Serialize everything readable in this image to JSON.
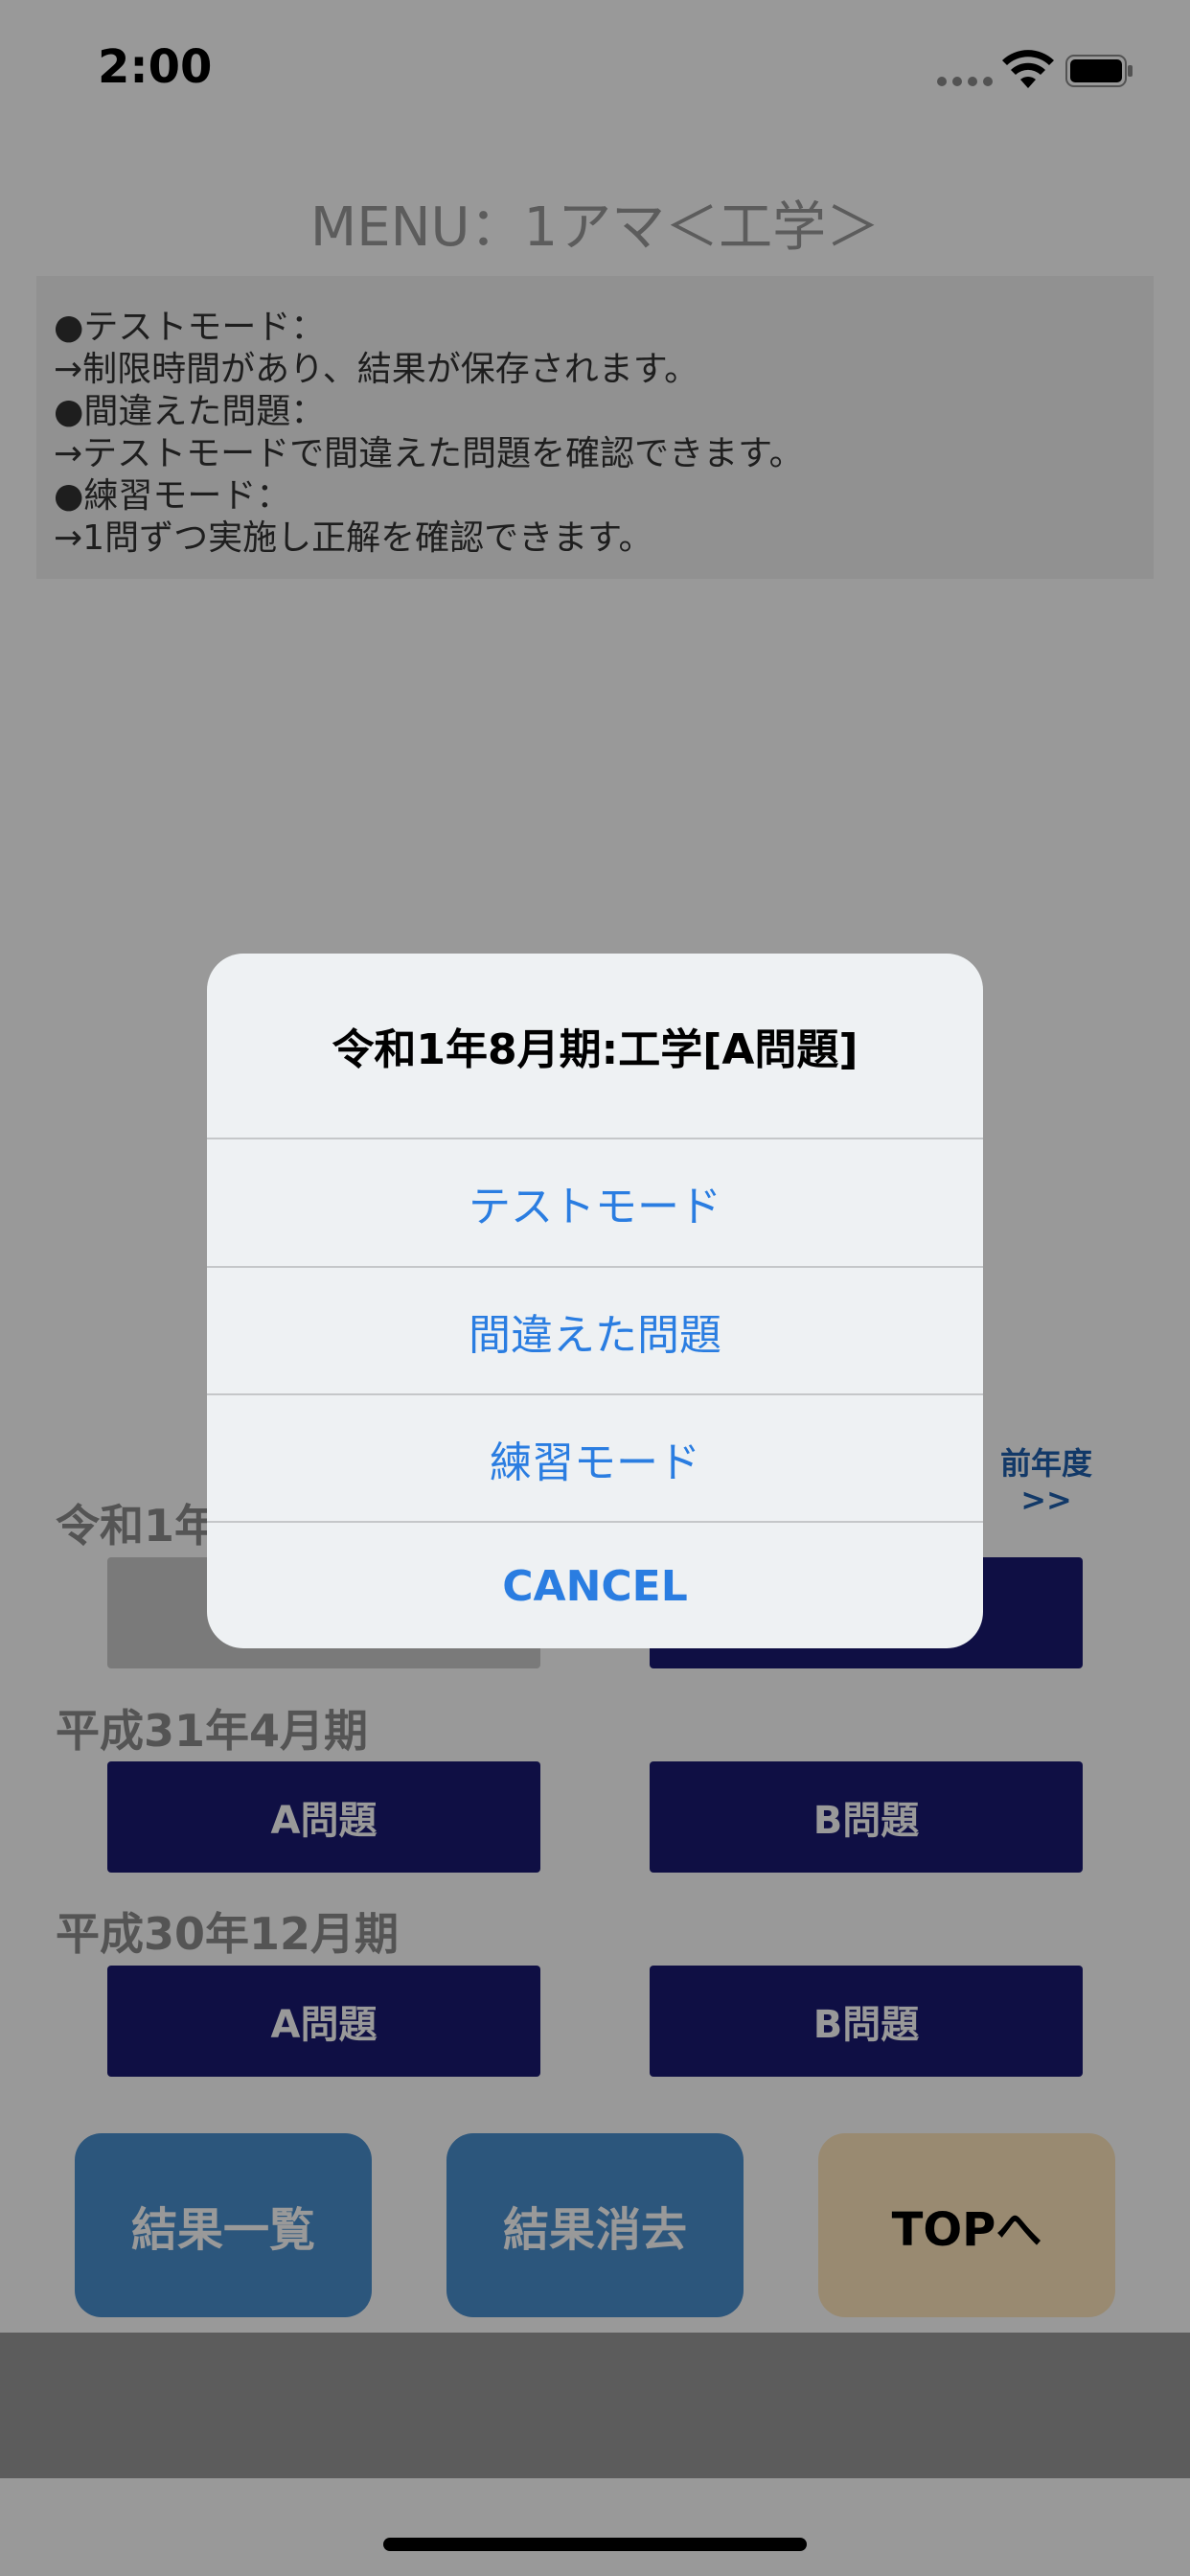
{
  "status_bar": {
    "time": "2:00",
    "icons": [
      "cellular-signal-icon",
      "wifi-icon",
      "battery-icon"
    ]
  },
  "page": {
    "title": "MENU：1アマ＜工学＞",
    "info_lines": [
      "●テストモード：",
      "→制限時間があり、結果が保存されます。",
      "●間違えた問題：",
      "→テストモードで間違えた問題を確認できます。",
      "●練習モード：",
      "→1問ずつ実施し正解を確認できます。"
    ],
    "prev_year_line1": "前年度",
    "prev_year_line2": ">>"
  },
  "sections": [
    {
      "label": "令和1年8月期",
      "a_button": "A問題",
      "b_button": "B問題"
    },
    {
      "label": "平成31年4月期",
      "a_button": "A問題",
      "b_button": "B問題"
    },
    {
      "label": "平成30年12月期",
      "a_button": "A問題",
      "b_button": "B問題"
    }
  ],
  "bottom_buttons": {
    "results_list": "結果一覧",
    "results_clear": "結果消去",
    "top": "TOPへ"
  },
  "alert": {
    "title": "令和1年8月期:工学[A問題]",
    "actions": [
      "テストモード",
      "間違えた問題",
      "練習モード"
    ],
    "cancel": "CANCEL"
  },
  "colors": {
    "accent": "#2a7de1",
    "question_button": "#1a1a72",
    "bottom_button_blue": "#4a8fcf",
    "bottom_button_tan": "#ffe7bd"
  }
}
